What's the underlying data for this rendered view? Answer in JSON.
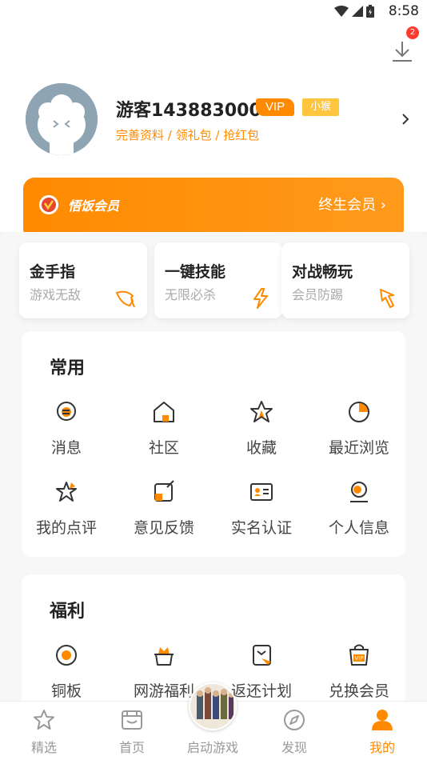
{
  "status_bar": {
    "time": "8:58"
  },
  "download": {
    "badge_count": "2"
  },
  "profile": {
    "username": "游客143883000",
    "vip_label": "VIP",
    "level_tag": "小猴",
    "links": "完善资料 / 领礼包 / 抢红包"
  },
  "member_banner": {
    "title": "悟饭会员",
    "right_label": "终生会员 ›"
  },
  "features": [
    {
      "title": "金手指",
      "subtitle": "游戏无敌",
      "icon": "wing-icon"
    },
    {
      "title": "一键技能",
      "subtitle": "无限必杀",
      "icon": "lightning-icon"
    },
    {
      "title": "对战畅玩",
      "subtitle": "会员防踢",
      "icon": "pointer-icon"
    }
  ],
  "common": {
    "title": "常用",
    "items": [
      {
        "label": "消息",
        "icon": "message-icon"
      },
      {
        "label": "社区",
        "icon": "community-icon"
      },
      {
        "label": "收藏",
        "icon": "favorite-icon"
      },
      {
        "label": "最近浏览",
        "icon": "recent-icon"
      },
      {
        "label": "我的点评",
        "icon": "review-icon"
      },
      {
        "label": "意见反馈",
        "icon": "feedback-icon"
      },
      {
        "label": "实名认证",
        "icon": "id-card-icon"
      },
      {
        "label": "个人信息",
        "icon": "person-icon"
      }
    ]
  },
  "welfare": {
    "title": "福利",
    "items": [
      {
        "label": "铜板",
        "icon": "coin-icon"
      },
      {
        "label": "网游福利",
        "icon": "gift-crown-icon"
      },
      {
        "label": "返还计划",
        "icon": "refund-icon"
      },
      {
        "label": "兑换会员",
        "icon": "vip-bag-icon"
      }
    ]
  },
  "bottom_nav": [
    {
      "label": "精选",
      "icon": "star-icon"
    },
    {
      "label": "首页",
      "icon": "shop-icon"
    },
    {
      "label": "启动游戏",
      "icon": "launch-game-icon"
    },
    {
      "label": "发现",
      "icon": "compass-icon"
    },
    {
      "label": "我的",
      "icon": "user-icon"
    }
  ],
  "colors": {
    "accent": "#ff8a00",
    "vip_gold": "#ffc53d"
  }
}
